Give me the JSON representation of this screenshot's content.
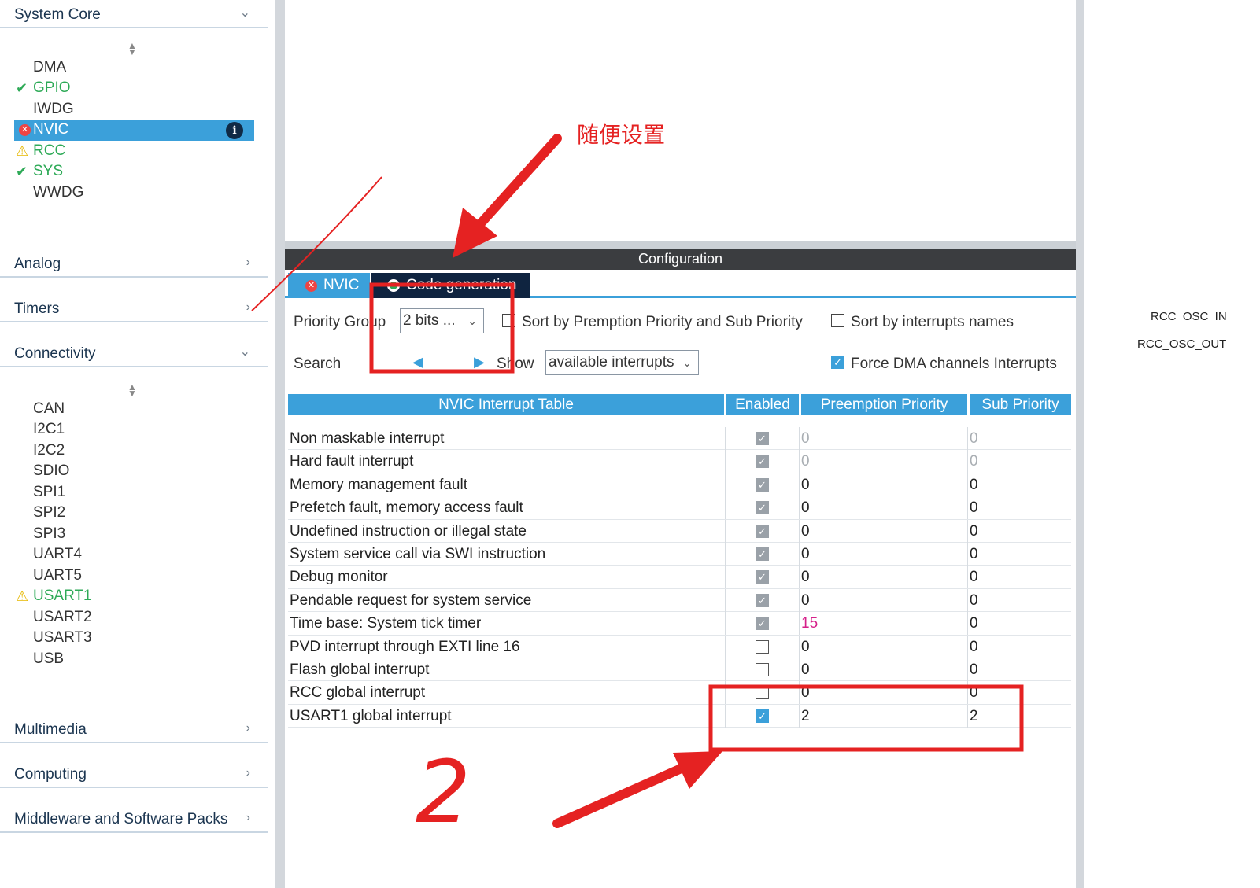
{
  "sidebar": {
    "categories": {
      "system_core": "System Core",
      "analog": "Analog",
      "timers": "Timers",
      "connectivity": "Connectivity",
      "multimedia": "Multimedia",
      "computing": "Computing",
      "middleware": "Middleware and Software Packs"
    },
    "system_core_items": [
      "DMA",
      "GPIO",
      "IWDG",
      "NVIC",
      "RCC",
      "SYS",
      "WWDG"
    ],
    "connectivity_items": [
      "CAN",
      "I2C1",
      "I2C2",
      "SDIO",
      "SPI1",
      "SPI2",
      "SPI3",
      "UART4",
      "UART5",
      "USART1",
      "USART2",
      "USART3",
      "USB"
    ]
  },
  "config": {
    "title": "Configuration",
    "tabs": {
      "nvic": "NVIC",
      "code": "Code generation"
    },
    "priority_group_label": "Priority Group",
    "priority_group_value": "2 bits ...",
    "sort_priority_label": "Sort by Premption Priority and Sub Priority",
    "sort_names_label": "Sort by interrupts names",
    "search_label": "Search",
    "show_label": "Show",
    "show_value": "available interrupts",
    "force_dma_label": "Force DMA channels Interrupts"
  },
  "table": {
    "headers": [
      "NVIC Interrupt Table",
      "Enabled",
      "Preemption Priority",
      "Sub Priority"
    ],
    "rows": [
      {
        "name": "Non maskable interrupt",
        "pre": "0",
        "sub": "0"
      },
      {
        "name": "Hard fault interrupt",
        "pre": "0",
        "sub": "0"
      },
      {
        "name": "Memory management fault",
        "pre": "0",
        "sub": "0"
      },
      {
        "name": "Prefetch fault, memory access fault",
        "pre": "0",
        "sub": "0"
      },
      {
        "name": "Undefined instruction or illegal state",
        "pre": "0",
        "sub": "0"
      },
      {
        "name": "System service call via SWI instruction",
        "pre": "0",
        "sub": "0"
      },
      {
        "name": "Debug monitor",
        "pre": "0",
        "sub": "0"
      },
      {
        "name": "Pendable request for system service",
        "pre": "0",
        "sub": "0"
      },
      {
        "name": "Time base: System tick timer",
        "pre": "15",
        "sub": "0"
      },
      {
        "name": "PVD interrupt through EXTI line 16",
        "pre": "0",
        "sub": "0"
      },
      {
        "name": "Flash global interrupt",
        "pre": "0",
        "sub": "0"
      },
      {
        "name": "RCC global interrupt",
        "pre": "0",
        "sub": "0"
      },
      {
        "name": "USART1 global interrupt",
        "pre": "2",
        "sub": "2"
      }
    ]
  },
  "pins": [
    "RCC_OSC_IN",
    "RCC_OSC_OUT"
  ],
  "annotations": {
    "note_cn": "随便设置",
    "handwritten": "2"
  },
  "colors": {
    "accent": "#3ba0da",
    "dark_tab": "#0f2440",
    "ok": "#2eaa57",
    "annotation": "#e52222"
  }
}
